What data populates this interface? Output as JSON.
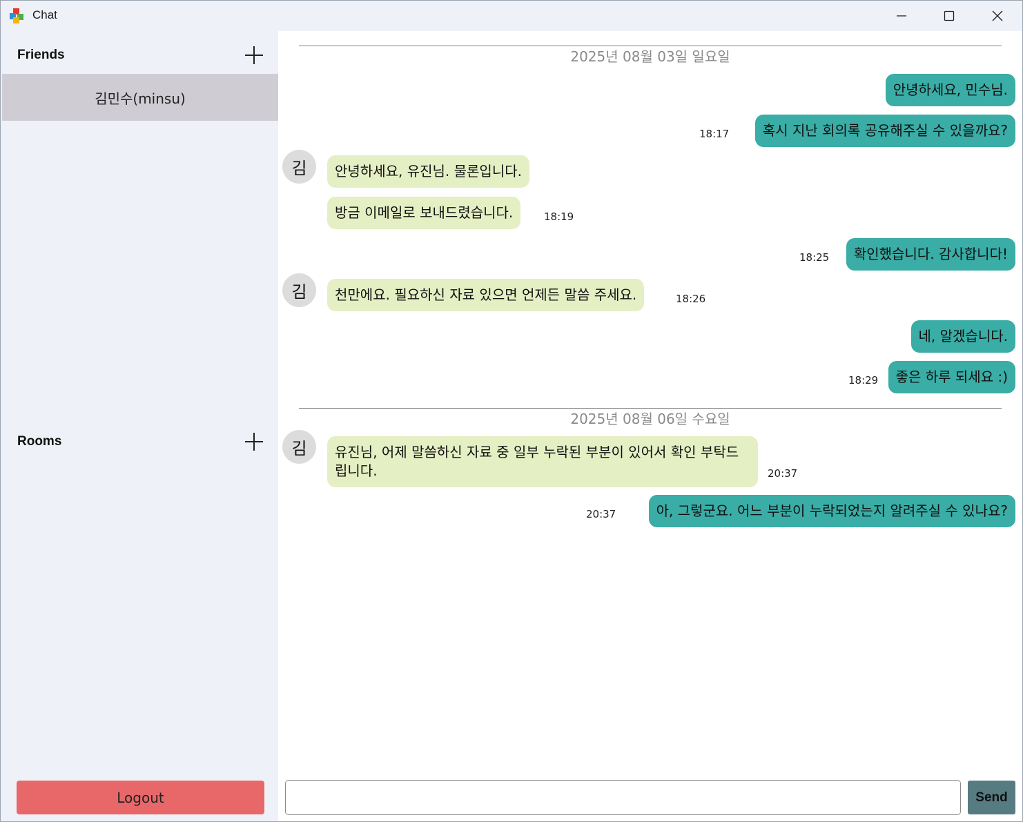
{
  "window": {
    "title": "Chat"
  },
  "sidebar": {
    "friends_title": "Friends",
    "friends": [
      "김민수(minsu)"
    ],
    "rooms_title": "Rooms",
    "logout_label": "Logout"
  },
  "chat": {
    "dates": [
      "2025년 08월 03일 일요일",
      "2025년 08월 06일 수요일"
    ],
    "avatar_initial": "김",
    "messages": [
      {
        "from": "me",
        "text": "안녕하세요, 민수님.",
        "time": ""
      },
      {
        "from": "me",
        "text": "혹시 지난 회의록 공유해주실 수 있을까요?",
        "time": "18:17"
      },
      {
        "from": "other",
        "text": "안녕하세요, 유진님. 물론입니다.",
        "time": ""
      },
      {
        "from": "other",
        "text": "방금 이메일로 보내드렸습니다.",
        "time": "18:19"
      },
      {
        "from": "me",
        "text": "확인했습니다. 감사합니다!",
        "time": "18:25"
      },
      {
        "from": "other",
        "text": "천만에요. 필요하신 자료 있으면 언제든 말씀 주세요.",
        "time": "18:26"
      },
      {
        "from": "me",
        "text": "네, 알겠습니다.",
        "time": ""
      },
      {
        "from": "me",
        "text": "좋은 하루 되세요 :)",
        "time": "18:29"
      },
      {
        "from": "other",
        "text": "유진님, 어제 말씀하신 자료 중 일부 누락된 부분이 있어서 확인 부탁드립니다.",
        "time": "20:37"
      },
      {
        "from": "me",
        "text": "아, 그렇군요. 어느 부분이 누락되었는지 알려주실 수 있나요?",
        "time": "20:37"
      }
    ]
  },
  "input": {
    "value": "",
    "send_label": "Send"
  }
}
